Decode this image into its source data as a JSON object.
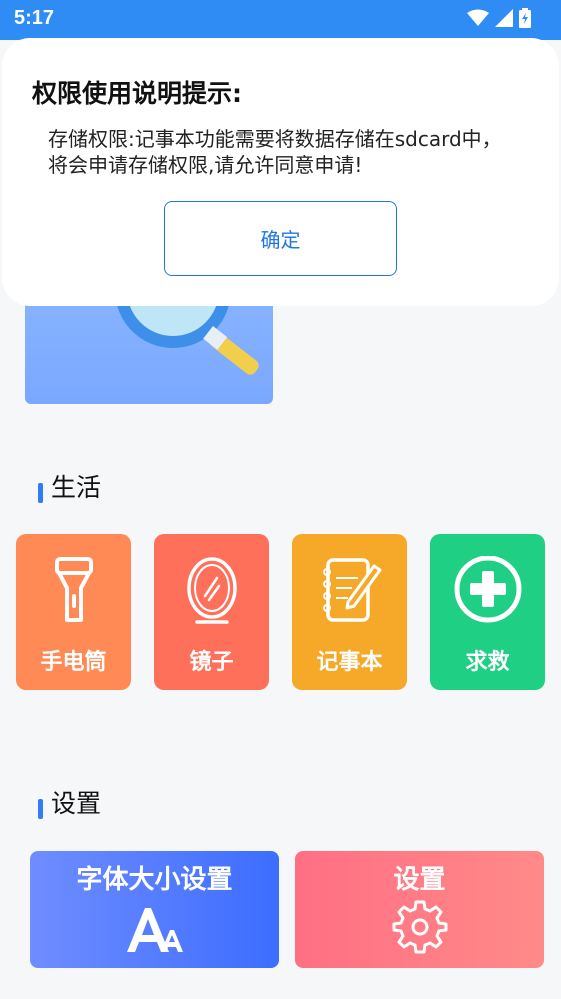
{
  "status_bar": {
    "time": "5:17",
    "icons": [
      "wifi-icon",
      "signal-icon",
      "battery-icon"
    ]
  },
  "dialog": {
    "title": "权限使用说明提示:",
    "message": "存储权限:记事本功能需要将数据存储在sdcard中，将会申请存储权限,请允许同意申请!",
    "confirm_label": "确定"
  },
  "sections": {
    "life": {
      "title": "生活",
      "items": [
        {
          "label": "手电筒",
          "icon": "flashlight-icon",
          "color": "#ff8a55"
        },
        {
          "label": "镜子",
          "icon": "mirror-icon",
          "color": "#ff705a"
        },
        {
          "label": "记事本",
          "icon": "notebook-icon",
          "color": "#f6a928"
        },
        {
          "label": "求救",
          "icon": "sos-plus-icon",
          "color": "#1fcf84"
        }
      ]
    },
    "settings": {
      "title": "设置",
      "items": [
        {
          "label": "字体大小设置",
          "icon": "font-size-icon",
          "color": "#4f7bff"
        },
        {
          "label": "设置",
          "icon": "gear-icon",
          "color": "#ff6f84"
        }
      ]
    }
  },
  "colors": {
    "status_bar": "#2f8cf5",
    "accent": "#1f77e6"
  }
}
